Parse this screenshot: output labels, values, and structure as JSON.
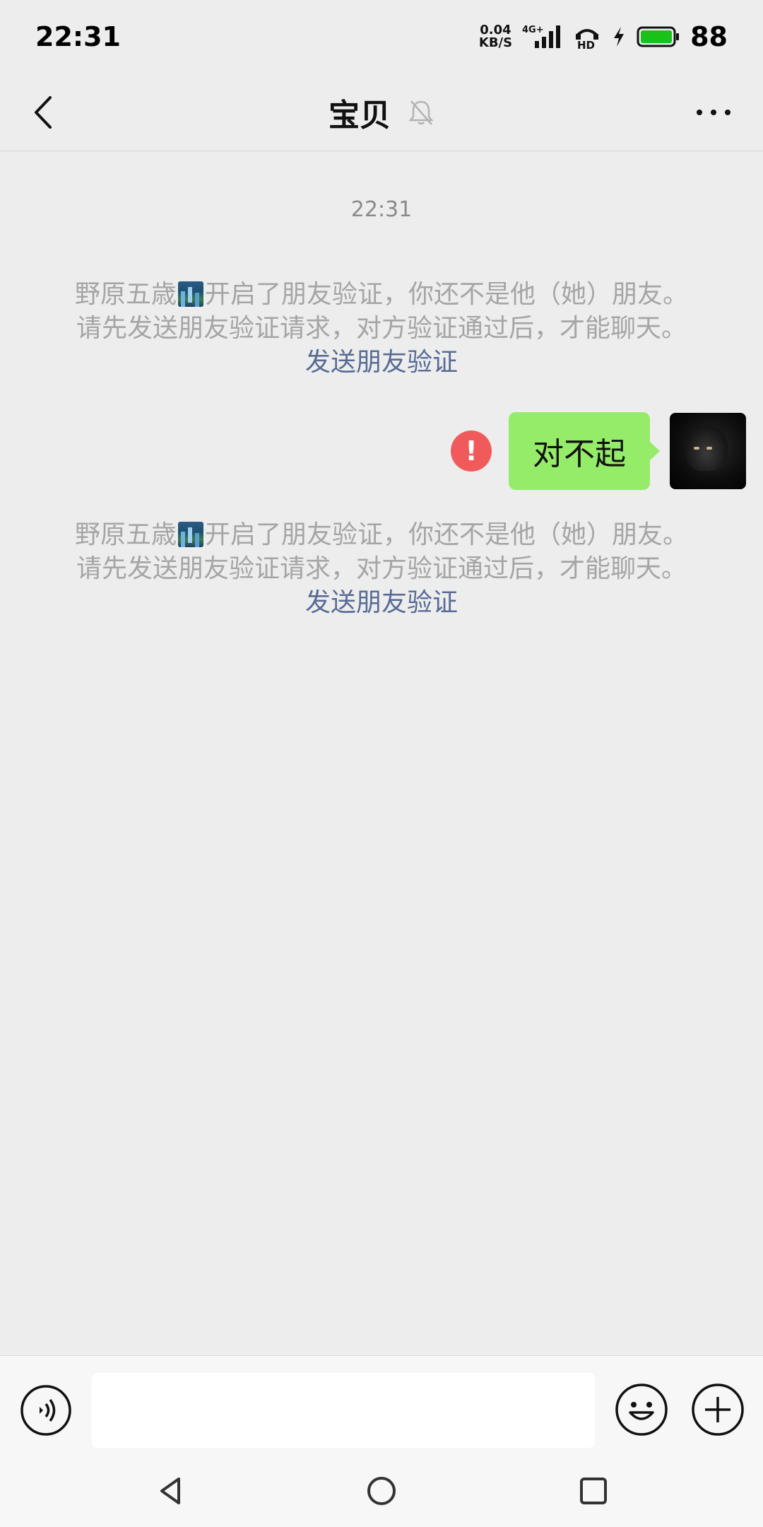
{
  "status_bar": {
    "time": "22:31",
    "net_speed_value": "0.04",
    "net_speed_unit": "KB/S",
    "network_label": "4G+",
    "hd_label": "HD",
    "battery": "88",
    "battery_color": "#19c119"
  },
  "header": {
    "title": "宝贝",
    "back_icon": "chevron-left-icon",
    "mute_icon": "bell-off-icon",
    "more_icon": "more-dots-icon"
  },
  "chat": {
    "timestamp": "22:31",
    "notices": [
      {
        "name_prefix": "野原五歳",
        "line1_suffix": "开启了朋友验证，你还不是他（她）朋友。",
        "line2": "请先发送朋友验证请求，对方验证通过后，才能聊天。",
        "link": "发送朋友验证"
      },
      {
        "name_prefix": "野原五歳",
        "line1_suffix": "开启了朋友验证，你还不是他（她）朋友。",
        "line2": "请先发送朋友验证请求，对方验证通过后，才能聊天。",
        "link": "发送朋友验证"
      }
    ],
    "message": {
      "text": "对不起",
      "error_mark": "!",
      "bubble_color": "#95ec69"
    }
  },
  "input_bar": {
    "value": "",
    "voice_icon": "voice-icon",
    "emoji_icon": "emoji-icon",
    "plus_icon": "plus-icon"
  },
  "colors": {
    "background": "#ededed",
    "link": "#576b95",
    "notice_text": "#a5a5a5",
    "error": "#f05a5a"
  }
}
